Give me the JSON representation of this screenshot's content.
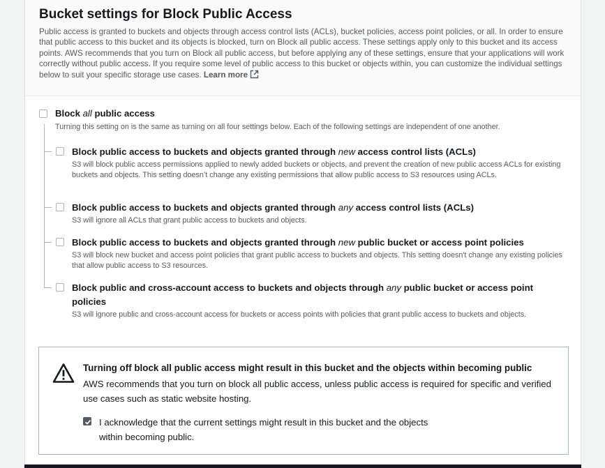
{
  "section": {
    "title": "Bucket settings for Block Public Access",
    "description": "Public access is granted to buckets and objects through access control lists (ACLs), bucket policies, access point policies, or all. In order to ensure that public access to this bucket and its objects is blocked, turn on Block all public access. These settings apply only to this bucket and its access points. AWS recommends that you turn on Block all public access, but before applying any of these settings, ensure that your applications will work correctly without public access. If you require some level of public access to this bucket or objects within, you can customize the individual settings below to suit your specific storage use cases.",
    "learn_more": "Learn more"
  },
  "block_all": {
    "label_pre": "Block ",
    "label_em": "all",
    "label_post": " public access",
    "checked": false,
    "description": "Turning this setting on is the same as turning on all four settings below. Each of the following settings are independent of one another."
  },
  "options": [
    {
      "label_pre": "Block public access to buckets and objects granted through ",
      "label_em": "new",
      "label_post": " access control lists (ACLs)",
      "checked": false,
      "description": "S3 will block public access permissions applied to newly added buckets or objects, and prevent the creation of new public access ACLs for existing buckets and objects. This setting doesn’t change any existing permissions that allow public access to S3 resources using ACLs."
    },
    {
      "label_pre": "Block public access to buckets and objects granted through ",
      "label_em": "any",
      "label_post": " access control lists (ACLs)",
      "checked": false,
      "description": "S3 will ignore all ACLs that grant public access to buckets and objects."
    },
    {
      "label_pre": "Block public access to buckets and objects granted through ",
      "label_em": "new",
      "label_post": " public bucket or access point policies",
      "checked": false,
      "description": "S3 will block new bucket and access point policies that grant public access to buckets and objects. This setting doesn't change any existing policies that allow public access to S3 resources."
    },
    {
      "label_pre": "Block public and cross-account access to buckets and objects through ",
      "label_em": "any",
      "label_post": " public bucket or access point",
      "label_line2": "policies",
      "checked": false,
      "description": "S3 will ignore public and cross-account access for buckets or access points with policies that grant public access to buckets and objects."
    }
  ],
  "warning": {
    "icon": "warning-triangle-icon",
    "title": "Turning off block all public access might result in this bucket and the objects within becoming public",
    "text": "AWS recommends that you turn on block all public access, unless public access is required for specific and verified use cases such as static website hosting.",
    "ack_label": "I acknowledge that the current settings might result in this bucket and the objects within becoming public.",
    "ack_checked": true
  },
  "colors": {
    "text_primary": "#16191f",
    "text_secondary": "#545b64",
    "border": "#aab7b8",
    "checkbox_checked": "#545b64"
  }
}
